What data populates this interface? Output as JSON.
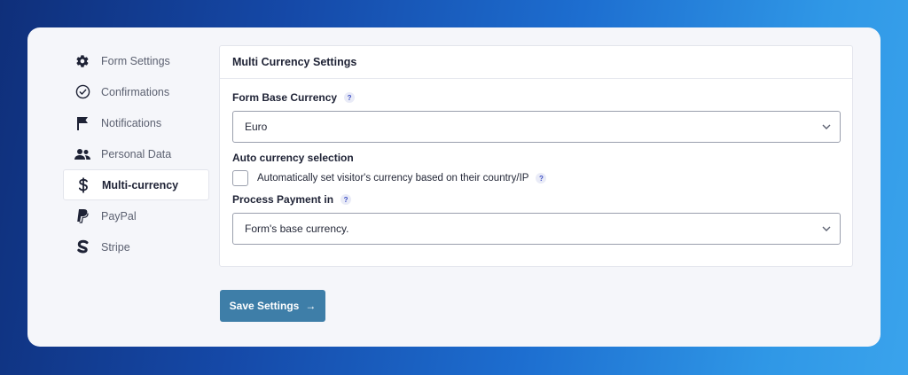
{
  "sidebar": {
    "items": [
      {
        "label": "Form Settings",
        "icon": "gear-icon"
      },
      {
        "label": "Confirmations",
        "icon": "check-circle-icon"
      },
      {
        "label": "Notifications",
        "icon": "flag-icon"
      },
      {
        "label": "Personal Data",
        "icon": "users-icon"
      },
      {
        "label": "Multi-currency",
        "icon": "dollar-icon",
        "active": true
      },
      {
        "label": "PayPal",
        "icon": "paypal-icon"
      },
      {
        "label": "Stripe",
        "icon": "stripe-icon"
      }
    ]
  },
  "panel": {
    "title": "Multi Currency Settings",
    "base_currency": {
      "label": "Form Base Currency",
      "help": "?",
      "value": "Euro"
    },
    "auto_selection": {
      "label": "Auto currency selection",
      "checkbox_label": "Automatically set visitor's currency based on their country/IP",
      "help": "?",
      "checked": false
    },
    "process_payment": {
      "label": "Process Payment in",
      "help": "?",
      "value": "Form's base currency."
    }
  },
  "save_button": {
    "label": "Save Settings",
    "arrow": "→"
  },
  "colors": {
    "accent": "#3e7ea8",
    "text": "#1e2235",
    "muted": "#5c6171"
  }
}
